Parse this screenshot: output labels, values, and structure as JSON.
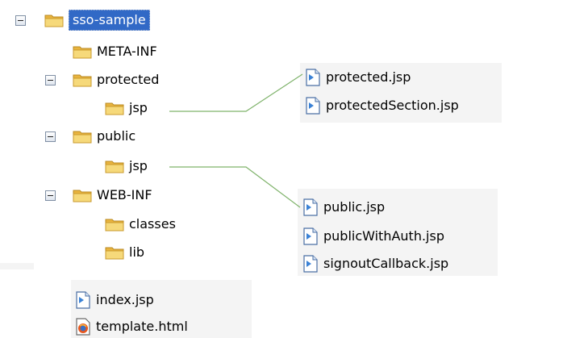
{
  "tree": {
    "root": {
      "label": "sso-sample",
      "icon": "folder-icon",
      "expanded": true
    },
    "children": [
      {
        "key": "meta_inf",
        "label": "META-INF",
        "icon": "folder-icon"
      },
      {
        "key": "protected",
        "label": "protected",
        "icon": "folder-icon",
        "expanded": true
      },
      {
        "key": "protected_jsp",
        "label": "jsp",
        "icon": "folder-icon"
      },
      {
        "key": "public",
        "label": "public",
        "icon": "folder-icon",
        "expanded": true
      },
      {
        "key": "public_jsp",
        "label": "jsp",
        "icon": "folder-icon"
      },
      {
        "key": "web_inf",
        "label": "WEB-INF",
        "icon": "folder-icon",
        "expanded": true
      },
      {
        "key": "classes",
        "label": "classes",
        "icon": "folder-icon"
      },
      {
        "key": "lib",
        "label": "lib",
        "icon": "folder-icon"
      }
    ]
  },
  "root_files": [
    {
      "label": "index.jsp",
      "icon": "jsp-file-icon"
    },
    {
      "label": "template.html",
      "icon": "html-file-icon"
    }
  ],
  "protected_files": [
    {
      "label": "protected.jsp",
      "icon": "jsp-file-icon"
    },
    {
      "label": "protectedSection.jsp",
      "icon": "jsp-file-icon"
    }
  ],
  "public_files": [
    {
      "label": "public.jsp",
      "icon": "jsp-file-icon"
    },
    {
      "label": "publicWithAuth.jsp",
      "icon": "jsp-file-icon"
    },
    {
      "label": "signoutCallback.jsp",
      "icon": "jsp-file-icon"
    }
  ],
  "colors": {
    "selection": "#3169c6",
    "connector": "#7fb36b",
    "folder": "#f4d36b"
  }
}
